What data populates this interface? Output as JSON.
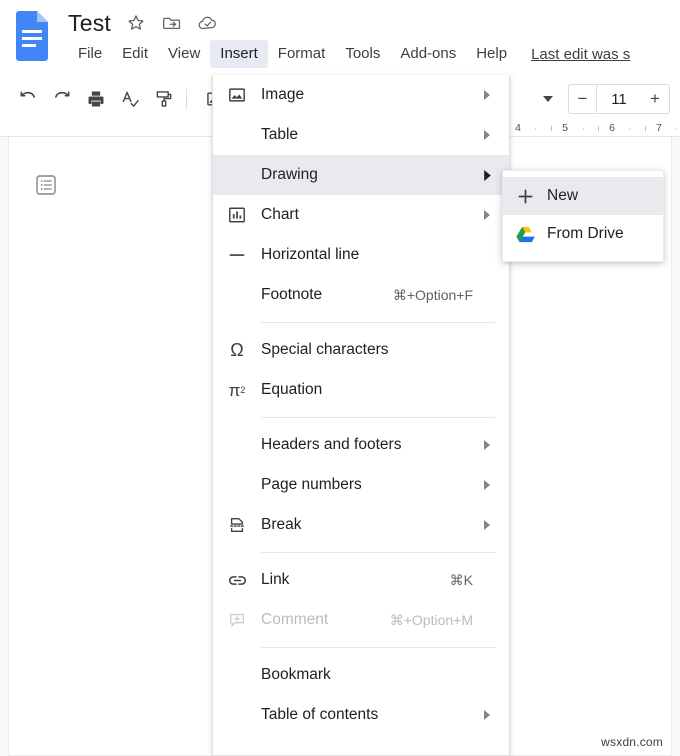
{
  "app": {
    "logo_icon": "google-docs-icon",
    "watermark": "wsxdn.com"
  },
  "header": {
    "doc_title": "Test",
    "title_icons": [
      {
        "name": "star-icon",
        "label": "Star"
      },
      {
        "name": "move-to-folder-icon",
        "label": "Move"
      },
      {
        "name": "cloud-saved-icon",
        "label": "Saved to Drive"
      }
    ],
    "menus": [
      {
        "label": "File",
        "active": false
      },
      {
        "label": "Edit",
        "active": false
      },
      {
        "label": "View",
        "active": false
      },
      {
        "label": "Insert",
        "active": true
      },
      {
        "label": "Format",
        "active": false
      },
      {
        "label": "Tools",
        "active": false
      },
      {
        "label": "Add-ons",
        "active": false
      },
      {
        "label": "Help",
        "active": false
      }
    ],
    "last_edit": "Last edit was s"
  },
  "toolbar": {
    "items": [
      {
        "name": "undo-icon",
        "label": "Undo"
      },
      {
        "name": "redo-icon",
        "label": "Redo"
      },
      {
        "name": "print-icon",
        "label": "Print"
      },
      {
        "name": "spellcheck-icon",
        "label": "Spelling and grammar check"
      },
      {
        "name": "paint-format-icon",
        "label": "Paint format"
      },
      {
        "name": "image-icon",
        "label": "Insert image"
      }
    ],
    "zoom_caret": "▾",
    "font_size": {
      "decrease": "−",
      "value": "11",
      "increase": "+"
    }
  },
  "ruler": {
    "numbers": [
      "4",
      "5",
      "6",
      "7"
    ]
  },
  "document": {
    "outline_icon": "document-outline-icon"
  },
  "insert_menu": {
    "groups": [
      {
        "items": [
          {
            "label": "Image",
            "icon": "image-icon",
            "shortcut": "",
            "arrow": true,
            "highlighted": false,
            "disabled": false
          },
          {
            "label": "Table",
            "icon": "",
            "shortcut": "",
            "arrow": true,
            "highlighted": false,
            "disabled": false
          },
          {
            "label": "Drawing",
            "icon": "",
            "shortcut": "",
            "arrow": true,
            "highlighted": true,
            "disabled": false
          },
          {
            "label": "Chart",
            "icon": "chart-icon",
            "shortcut": "",
            "arrow": true,
            "highlighted": false,
            "disabled": false
          },
          {
            "label": "Horizontal line",
            "icon": "horizontal-line-icon",
            "shortcut": "",
            "arrow": false,
            "highlighted": false,
            "disabled": false
          },
          {
            "label": "Footnote",
            "icon": "",
            "shortcut": "⌘+Option+F",
            "arrow": false,
            "highlighted": false,
            "disabled": false
          }
        ]
      },
      {
        "items": [
          {
            "label": "Special characters",
            "icon": "omega-icon",
            "shortcut": "",
            "arrow": false,
            "highlighted": false,
            "disabled": false
          },
          {
            "label": "Equation",
            "icon": "equation-icon",
            "shortcut": "",
            "arrow": false,
            "highlighted": false,
            "disabled": false
          }
        ]
      },
      {
        "items": [
          {
            "label": "Headers and footers",
            "icon": "",
            "shortcut": "",
            "arrow": true,
            "highlighted": false,
            "disabled": false
          },
          {
            "label": "Page numbers",
            "icon": "",
            "shortcut": "",
            "arrow": true,
            "highlighted": false,
            "disabled": false
          },
          {
            "label": "Break",
            "icon": "break-icon",
            "shortcut": "",
            "arrow": true,
            "highlighted": false,
            "disabled": false
          }
        ]
      },
      {
        "items": [
          {
            "label": "Link",
            "icon": "link-icon",
            "shortcut": "⌘K",
            "arrow": false,
            "highlighted": false,
            "disabled": false
          },
          {
            "label": "Comment",
            "icon": "comment-icon",
            "shortcut": "⌘+Option+M",
            "arrow": false,
            "highlighted": false,
            "disabled": true
          }
        ]
      },
      {
        "items": [
          {
            "label": "Bookmark",
            "icon": "",
            "shortcut": "",
            "arrow": false,
            "highlighted": false,
            "disabled": false
          },
          {
            "label": "Table of contents",
            "icon": "",
            "shortcut": "",
            "arrow": true,
            "highlighted": false,
            "disabled": false
          }
        ]
      }
    ]
  },
  "drawing_submenu": {
    "items": [
      {
        "label": "New",
        "icon": "plus-icon",
        "highlighted": true
      },
      {
        "label": "From Drive",
        "icon": "google-drive-icon",
        "highlighted": false
      }
    ]
  },
  "colors": {
    "accent_blue": "#4285f4",
    "menu_highlight": "#e8eaed",
    "tab_highlight": "#e8eaf3",
    "text_primary": "#202124",
    "text_secondary": "#5f6368",
    "canvas_bg": "#f8f9fa"
  }
}
